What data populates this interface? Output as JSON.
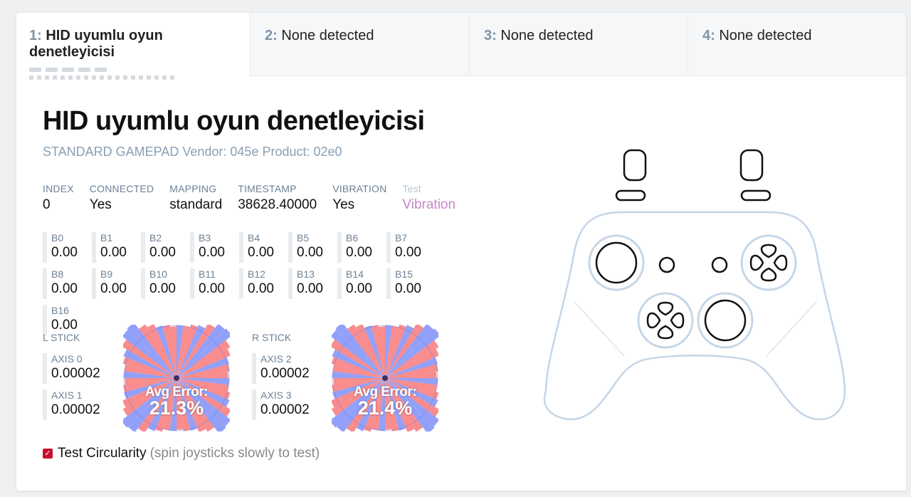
{
  "tabs": [
    {
      "num": "1:",
      "label": "HID uyumlu oyun denetleyicisi"
    },
    {
      "num": "2:",
      "label": "None detected"
    },
    {
      "num": "3:",
      "label": "None detected"
    },
    {
      "num": "4:",
      "label": "None detected"
    }
  ],
  "gamepad": {
    "title": "HID uyumlu oyun denetleyicisi",
    "subtitle": "STANDARD GAMEPAD Vendor: 045e Product: 02e0"
  },
  "meta": {
    "index": {
      "label": "INDEX",
      "value": "0"
    },
    "connected": {
      "label": "CONNECTED",
      "value": "Yes"
    },
    "mapping": {
      "label": "MAPPING",
      "value": "standard"
    },
    "timestamp": {
      "label": "TIMESTAMP",
      "value": "38628.40000"
    },
    "vibration": {
      "label": "VIBRATION",
      "value": "Yes"
    },
    "test": {
      "label": "Test",
      "value": "Vibration"
    }
  },
  "buttons": [
    {
      "label": "B0",
      "value": "0.00"
    },
    {
      "label": "B1",
      "value": "0.00"
    },
    {
      "label": "B2",
      "value": "0.00"
    },
    {
      "label": "B3",
      "value": "0.00"
    },
    {
      "label": "B4",
      "value": "0.00"
    },
    {
      "label": "B5",
      "value": "0.00"
    },
    {
      "label": "B6",
      "value": "0.00"
    },
    {
      "label": "B7",
      "value": "0.00"
    },
    {
      "label": "B8",
      "value": "0.00"
    },
    {
      "label": "B9",
      "value": "0.00"
    },
    {
      "label": "B10",
      "value": "0.00"
    },
    {
      "label": "B11",
      "value": "0.00"
    },
    {
      "label": "B12",
      "value": "0.00"
    },
    {
      "label": "B13",
      "value": "0.00"
    },
    {
      "label": "B14",
      "value": "0.00"
    },
    {
      "label": "B15",
      "value": "0.00"
    },
    {
      "label": "B16",
      "value": "0.00"
    }
  ],
  "sticks": {
    "left": {
      "label": "L STICK",
      "axis_x": {
        "label": "AXIS 0",
        "value": "0.00002"
      },
      "axis_y": {
        "label": "AXIS 1",
        "value": "0.00002"
      },
      "error_label": "Avg Error:",
      "error_value": "21.3%"
    },
    "right": {
      "label": "R STICK",
      "axis_x": {
        "label": "AXIS 2",
        "value": "0.00002"
      },
      "axis_y": {
        "label": "AXIS 3",
        "value": "0.00002"
      },
      "error_label": "Avg Error:",
      "error_value": "21.4%"
    }
  },
  "circularity": {
    "checked": true,
    "label": "Test Circularity",
    "hint": "(spin joysticks slowly to test)"
  },
  "colors": {
    "accent_label": "#6d8196",
    "vibration_link": "#c985c8",
    "checkbox": "#c8102e",
    "plot_red": "#f87f7f",
    "plot_blue": "#7f8ff8",
    "controller_outline": "#c5d6e6"
  }
}
